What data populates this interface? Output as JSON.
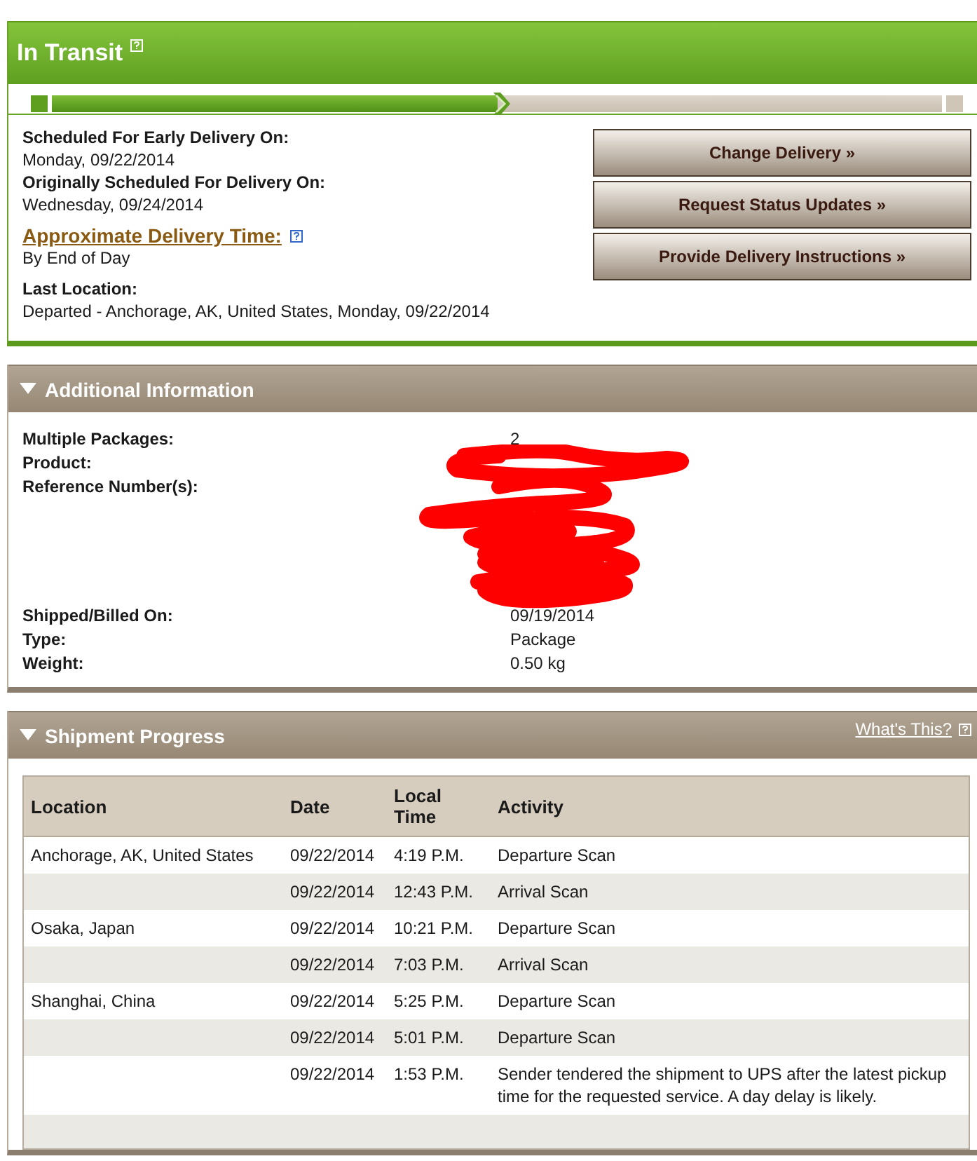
{
  "status": {
    "title": "In Transit",
    "level": 0.5
  },
  "delivery": [
    {
      "label": "Scheduled For Early Delivery On:",
      "value": "Monday, 09/22/2014",
      "kind": "plain"
    },
    {
      "label": "Originally Scheduled For Delivery On:",
      "value": "Wednesday, 09/24/2014",
      "kind": "plain"
    },
    {
      "label": "Approximate Delivery Time:",
      "value": "By End of Day",
      "kind": "link"
    },
    {
      "label": "Last Location:",
      "value": "Departed - Anchorage, AK, United States, Monday, 09/22/2014",
      "kind": "plain"
    }
  ],
  "buttons": [
    "Change Delivery »",
    "Request Status Updates »",
    "Provide Delivery Instructions »"
  ],
  "additional_information": {
    "title": "Additional Information",
    "expanded": true,
    "rows": [
      {
        "label": "Multiple Packages:",
        "value": "2"
      },
      {
        "label": "Product:"
      },
      {
        "label": "Reference Number(s):"
      },
      {
        "label": "Shipped/Billed On:",
        "value": "09/19/2014"
      },
      {
        "label": "Type:",
        "value": "Package"
      },
      {
        "label": "Weight:",
        "value": "0.50 kg"
      }
    ]
  },
  "shipment_progress": {
    "title": "Shipment Progress",
    "expanded": true,
    "help_link": "What's This?",
    "columns": [
      "Location",
      "Date",
      "Local Time",
      "Activity"
    ],
    "rows": [
      {
        "location": "Anchorage, AK, United States",
        "date": "09/22/2014",
        "time": "4:19 P.M.",
        "activity": "Departure Scan"
      },
      {
        "date": "09/22/2014",
        "time": "12:43 P.M.",
        "activity": "Arrival Scan"
      },
      {
        "location": "Osaka, Japan",
        "date": "09/22/2014",
        "time": "10:21 P.M.",
        "activity": "Departure Scan"
      },
      {
        "date": "09/22/2014",
        "time": "7:03 P.M.",
        "activity": "Arrival Scan"
      },
      {
        "location": "Shanghai, China",
        "date": "09/22/2014",
        "time": "5:25 P.M.",
        "activity": "Departure Scan"
      },
      {
        "date": "09/22/2014",
        "time": "5:01 P.M.",
        "activity": "Departure Scan"
      },
      {
        "date": "09/22/2014",
        "time": "1:53 P.M.",
        "activity": "Sender tendered the shipment to UPS after the latest pickup time for the requested service. A day delay is likely."
      }
    ]
  }
}
